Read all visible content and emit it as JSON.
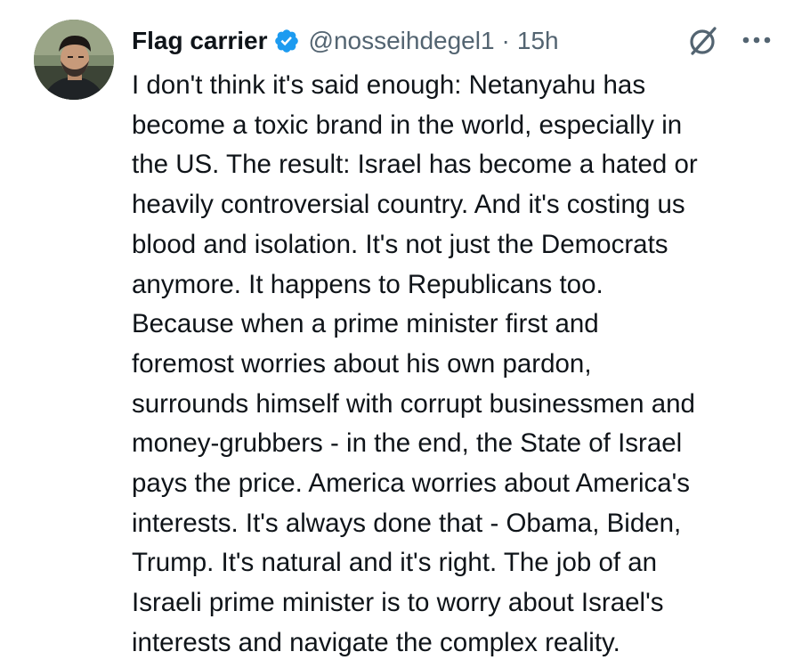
{
  "post": {
    "author": {
      "display_name": "Flag carrier",
      "handle": "@nosseihdegel1",
      "verified": true,
      "avatar_icon": "profile-photo"
    },
    "separator": "·",
    "timestamp": "15h",
    "icons": {
      "grok": "slashed-circle-icon",
      "more": "more-options-icon"
    },
    "text": "I don't think it's said enough: Netanyahu has\nbecome a toxic brand in the world, especially in\nthe US. The result: Israel has become a hated or\nheavily controversial country. And it's costing us\nblood and isolation. It's not just the Democrats\nanymore. It happens to Republicans too.\nBecause when a prime minister first and\nforemost worries about his own pardon,\nsurrounds himself with corrupt businessmen and\nmoney-grubbers - in the end, the State of Israel\npays the price. America worries about America's\ninterests. It's always done that - Obama, Biden,\nTrump. It's natural and it's right. The job of an\nIsraeli prime minister is to worry about Israel's\ninterests and navigate the complex reality."
  },
  "colors": {
    "text": "#0f1419",
    "secondary": "#536471",
    "verified": "#1d9bf0",
    "background": "#ffffff"
  }
}
